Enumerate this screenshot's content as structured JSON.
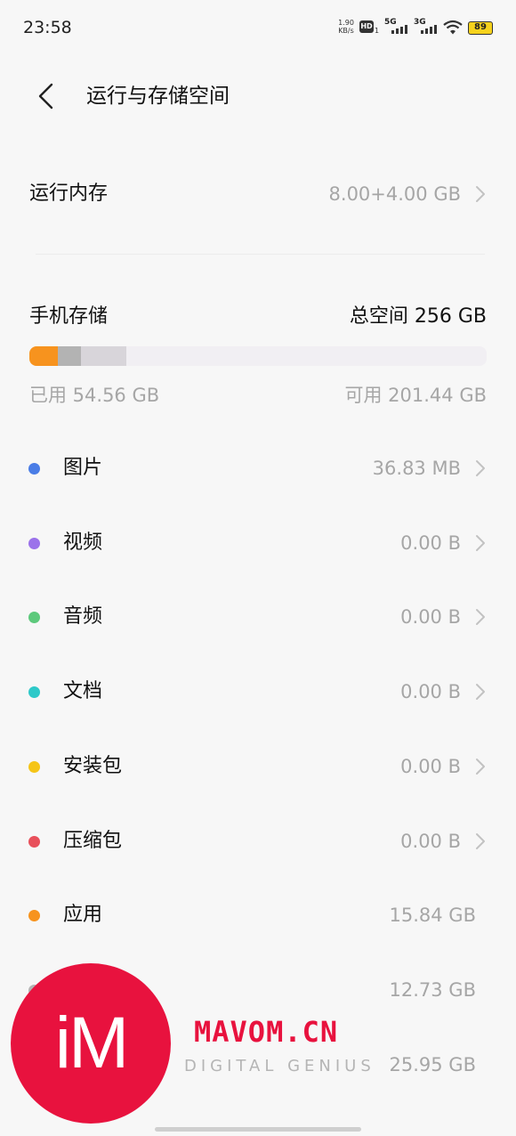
{
  "status_bar": {
    "time": "23:58",
    "net_speed_value": "1.90",
    "net_speed_unit": "KB/s",
    "hd_label": "HD",
    "hd_sub": "1",
    "signal_1": "5G",
    "signal_2": "3G",
    "battery": "89"
  },
  "header": {
    "title": "运行与存储空间"
  },
  "ram": {
    "label": "运行内存",
    "value": "8.00+4.00 GB"
  },
  "storage": {
    "label": "手机存储",
    "total": "总空间 256 GB",
    "used": "已用 54.56 GB",
    "available": "可用 201.44 GB",
    "bar_segments": [
      {
        "name": "apps",
        "fraction": 0.062,
        "color": "#f7931e"
      },
      {
        "name": "other",
        "fraction": 0.05,
        "color": "#b3b3b3"
      },
      {
        "name": "system",
        "fraction": 0.101,
        "color": "#d8d5da"
      }
    ]
  },
  "categories": [
    {
      "label": "图片",
      "value": "36.83 MB",
      "color": "#4a7de6",
      "chevron": true
    },
    {
      "label": "视频",
      "value": "0.00 B",
      "color": "#9b72ea",
      "chevron": true
    },
    {
      "label": "音频",
      "value": "0.00 B",
      "color": "#5dc97c",
      "chevron": true
    },
    {
      "label": "文档",
      "value": "0.00 B",
      "color": "#2ec9c9",
      "chevron": true
    },
    {
      "label": "安装包",
      "value": "0.00 B",
      "color": "#f5c518",
      "chevron": true
    },
    {
      "label": "压缩包",
      "value": "0.00 B",
      "color": "#e8505b",
      "chevron": true
    },
    {
      "label": "应用",
      "value": "15.84 GB",
      "color": "#f7931e",
      "chevron": false
    },
    {
      "label": "",
      "value": "12.73 GB",
      "color": "#b3b3b3",
      "chevron": false
    },
    {
      "label": "",
      "value": "25.95 GB",
      "color": "#d8d5da",
      "chevron": false
    }
  ],
  "watermark": {
    "logo_text": "iM",
    "brand": "MAVOM.CN",
    "tagline": "DIGITAL GENIUS"
  }
}
